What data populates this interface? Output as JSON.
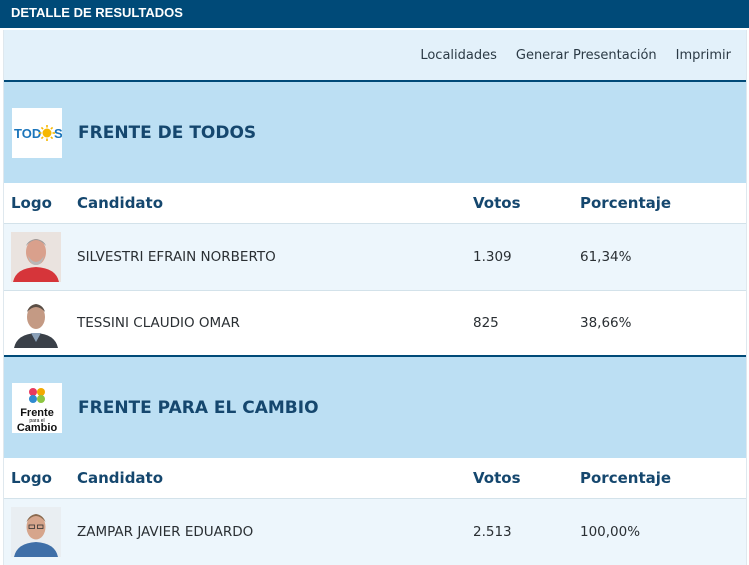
{
  "header": {
    "title": "DETALLE DE RESULTADOS"
  },
  "toolbar": {
    "localidades": "Localidades",
    "generar": "Generar Presentación",
    "imprimir": "Imprimir"
  },
  "columns": {
    "logo": "Logo",
    "candidato": "Candidato",
    "votos": "Votos",
    "porcentaje": "Porcentaje"
  },
  "parties": [
    {
      "name": "FRENTE DE TODOS",
      "logo_text": "TOD",
      "logo_text_2": "S",
      "candidates": [
        {
          "name": "SILVESTRI EFRAIN NORBERTO",
          "votos": "1.309",
          "porcentaje": "61,34%"
        },
        {
          "name": "TESSINI CLAUDIO OMAR",
          "votos": "825",
          "porcentaje": "38,66%"
        }
      ]
    },
    {
      "name": "FRENTE PARA EL CAMBIO",
      "logo_text": "Frente",
      "logo_text_2": "para el",
      "logo_text_3": "Cambio",
      "candidates": [
        {
          "name": "ZAMPAR JAVIER EDUARDO",
          "votos": "2.513",
          "porcentaje": "100,00%"
        }
      ]
    }
  ],
  "colors": {
    "primary": "#004a78",
    "party_bg": "#bcdff3",
    "toolbar_bg": "#e3f1fa"
  }
}
